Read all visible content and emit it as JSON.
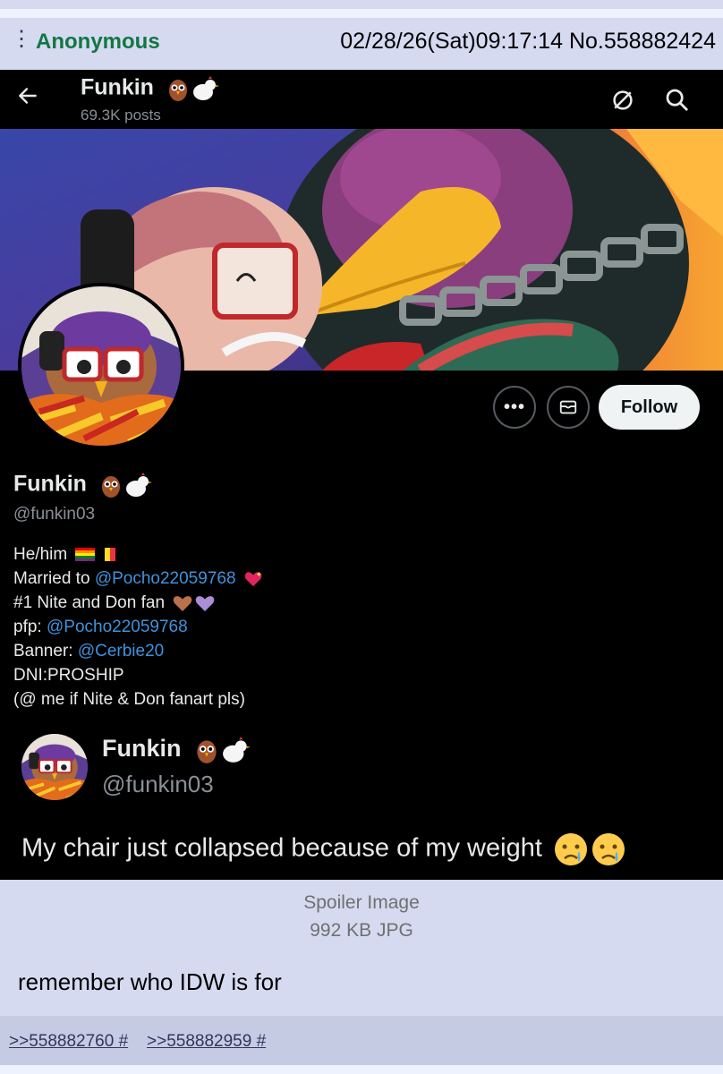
{
  "post": {
    "menu_icon": "vertical-dots-icon",
    "name": "Anonymous",
    "datetime": "02/28/26(Sat)09:17:14",
    "number": "No.558882424",
    "file_label": "Spoiler Image",
    "file_info": "992 KB JPG",
    "comment": "remember who IDW is for",
    "replies": [
      ">>558882760 #",
      ">>558882959 #"
    ]
  },
  "twitter": {
    "header_title": "Funkin",
    "post_count": "69.3K posts",
    "back_icon": "arrow-left-icon",
    "mute_icon": "mute-icon",
    "search_icon": "search-icon",
    "more_label": "•••",
    "message_icon": "envelope-icon",
    "follow_label": "Follow",
    "profile": {
      "name": "Funkin",
      "handle": "@funkin03",
      "bio": {
        "l1": "He/him",
        "l2_prefix": "Married to ",
        "l2_mention": "@Pocho22059768",
        "l3": "#1 Nite and Don fan",
        "l4_prefix": "pfp: ",
        "l4_mention": "@Pocho22059768",
        "l5_prefix": "Banner: ",
        "l5_mention": "@Cerbie20",
        "l6": "DNI:PROSHIP",
        "l7": "(@ me if Nite & Don fanart pls)"
      }
    },
    "tweet": {
      "name": "Funkin",
      "handle": "@funkin03",
      "text": "My chair just collapsed because of my weight"
    }
  },
  "colors": {
    "board_bg": "#eef2ff",
    "post_bg": "#d6daf0",
    "name_green": "#117743",
    "mention_blue": "#3f92dd",
    "link_color": "#34345c"
  }
}
